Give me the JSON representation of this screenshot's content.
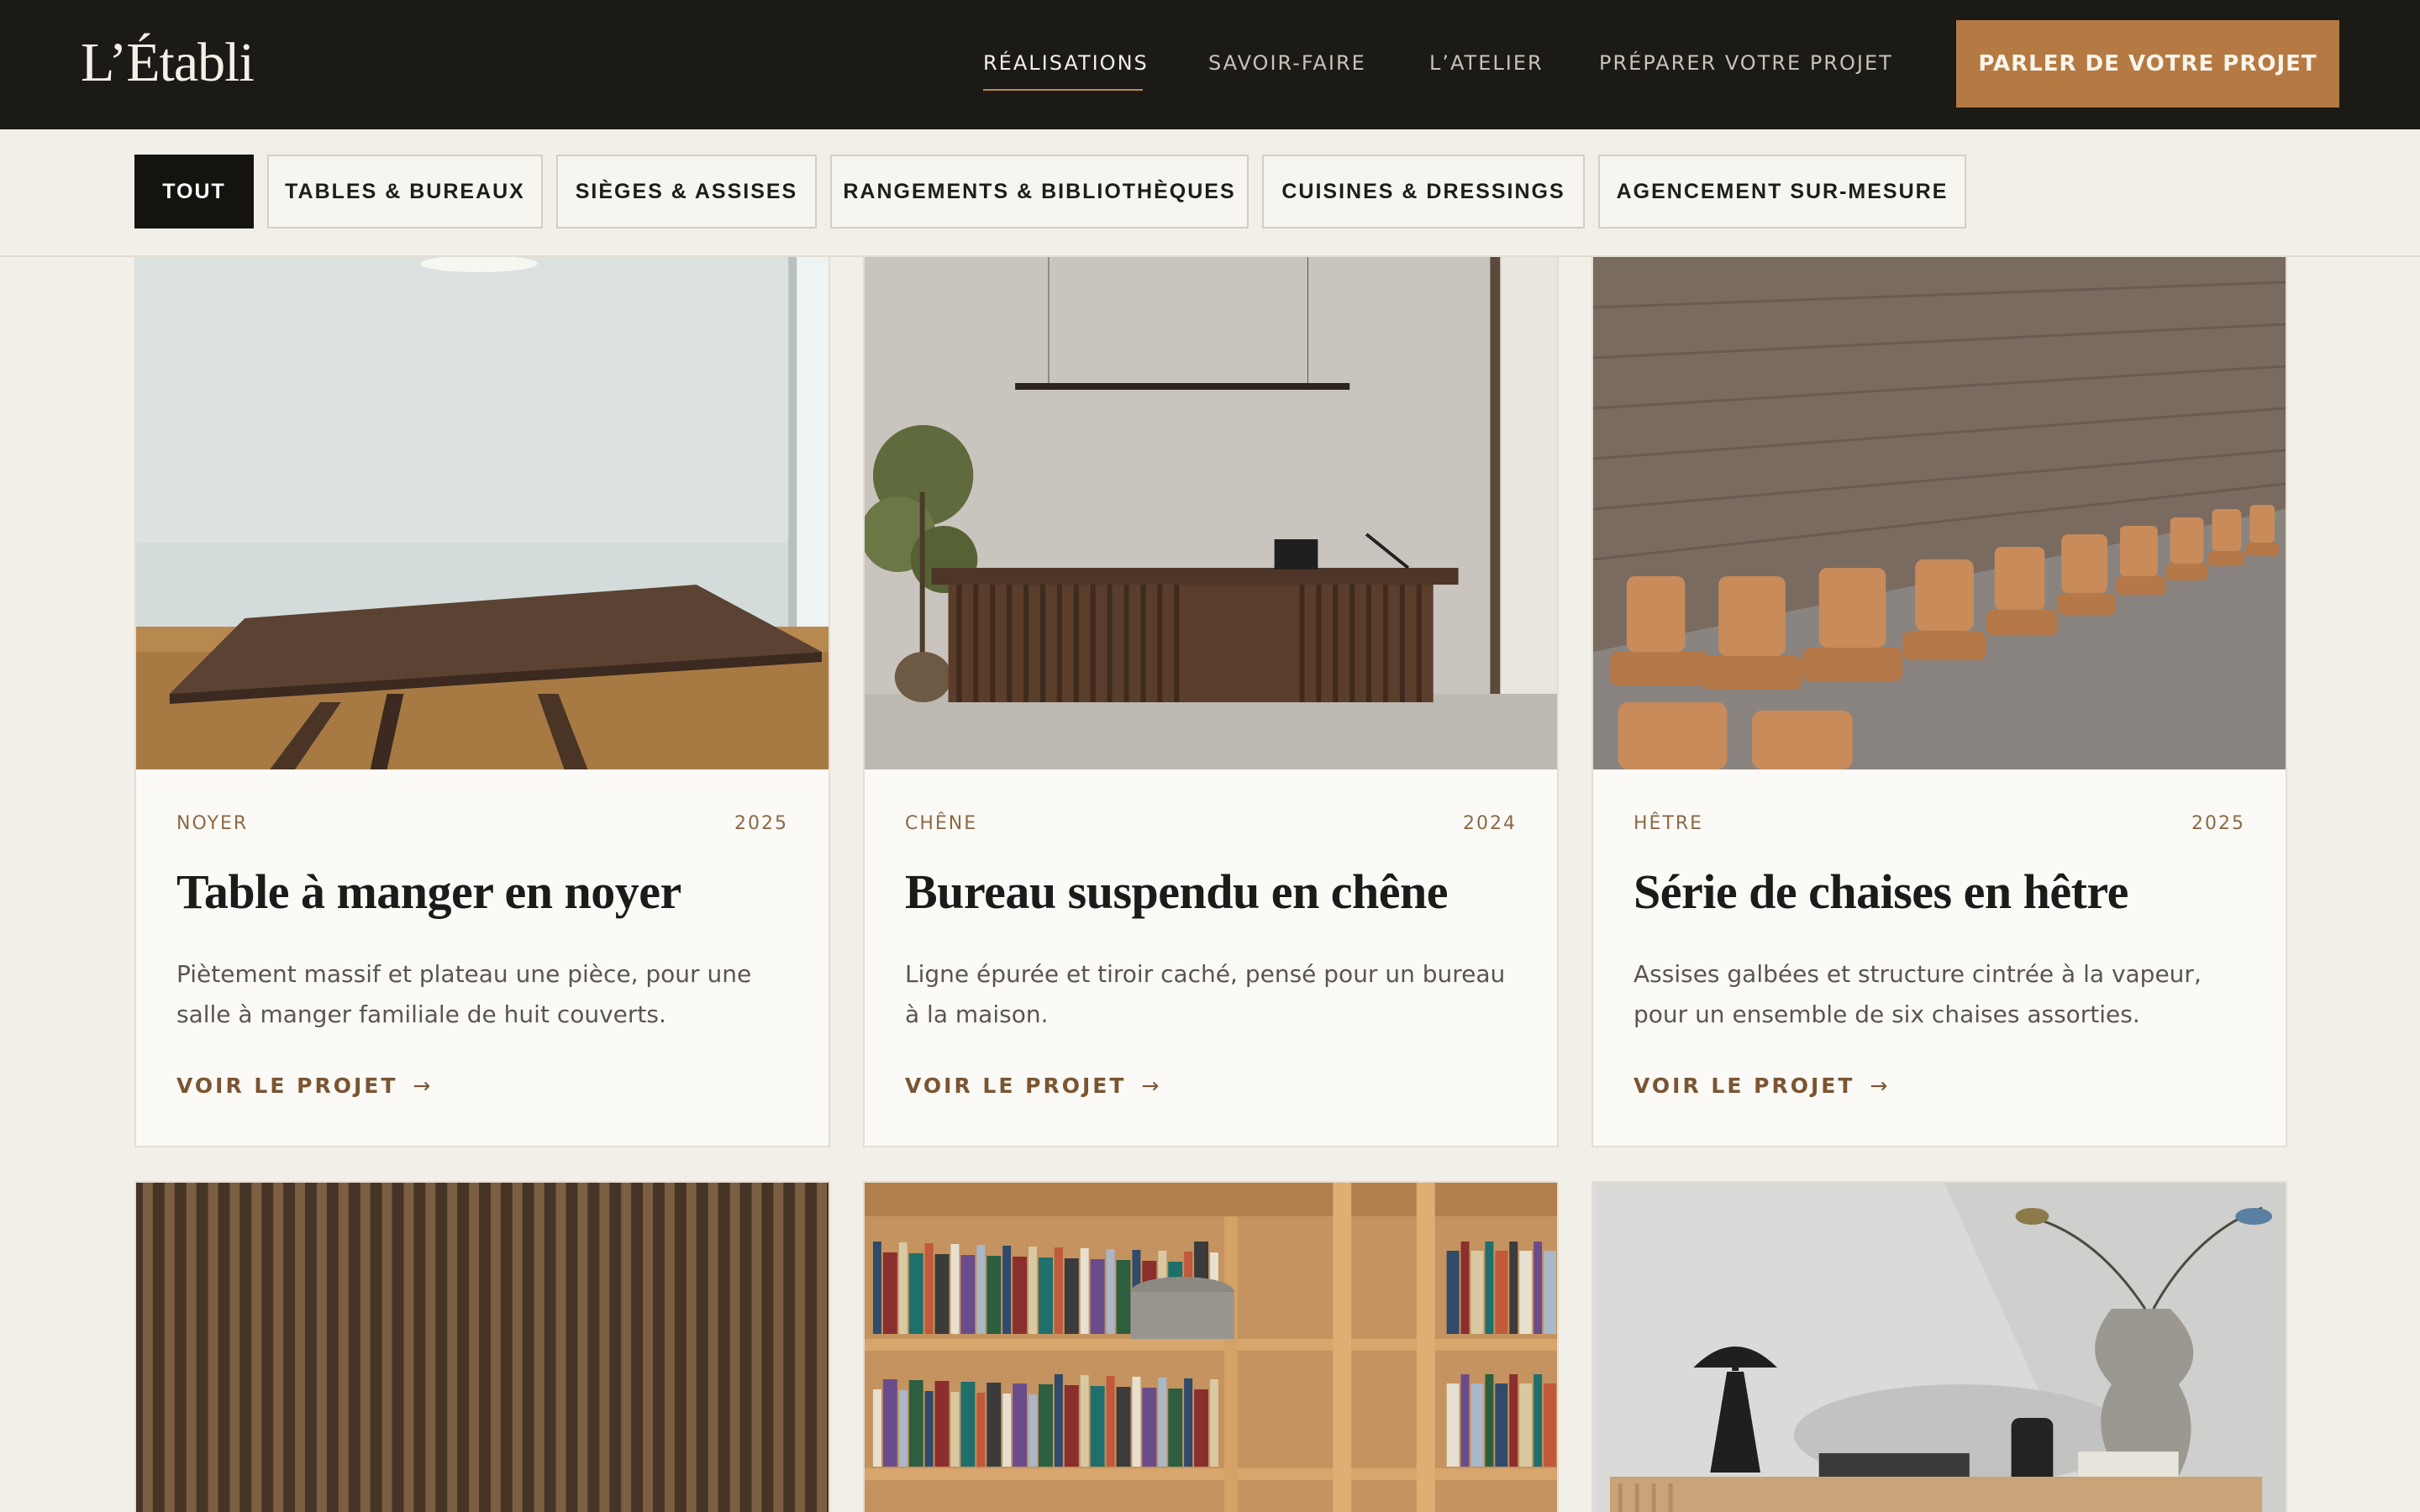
{
  "brand": {
    "logo": "L’Établi"
  },
  "nav": {
    "items": [
      "RÉALISATIONS",
      "SAVOIR-FAIRE",
      "L’ATELIER",
      "PRÉPARER VOTRE PROJET"
    ],
    "active_index": 0,
    "cta_label": "PARLER DE VOTRE PROJET"
  },
  "filters": {
    "items": [
      "TOUT",
      "TABLES & BUREAUX",
      "SIÈGES & ASSISES",
      "RANGEMENTS & BIBLIOTHÈQUES",
      "CUISINES & DRESSINGS",
      "AGENCEMENT SUR-MESURE"
    ],
    "active_index": 0
  },
  "projects": [
    {
      "material": "NOYER",
      "year": "2025",
      "title": "Table à manger en noyer",
      "description": "Piètement massif et plateau une pièce, pour une salle à manger familiale de huit couverts.",
      "link_label": "VOIR LE PROJET",
      "image": "walnut-dining-table"
    },
    {
      "material": "CHÊNE",
      "year": "2024",
      "title": "Bureau suspendu en chêne",
      "description": "Ligne épurée et tiroir caché, pensé pour un bureau à la maison.",
      "link_label": "VOIR LE PROJET",
      "image": "oak-desk"
    },
    {
      "material": "HÊTRE",
      "year": "2025",
      "title": "Série de chaises en hêtre",
      "description": "Assises galbées et structure cintrée à la vapeur, pour un ensemble de six chaises assorties.",
      "link_label": "VOIR LE PROJET",
      "image": "beech-chairs-row"
    },
    {
      "image": "wood-slat-wall"
    },
    {
      "image": "bookshelf-with-ladder"
    },
    {
      "image": "sideboard-with-lamp-and-vase"
    }
  ],
  "icons": {
    "arrow": "→",
    "arrow_name": "arrow-right-icon"
  },
  "colors": {
    "header_bg": "#1b1a17",
    "accent": "#b57a43",
    "meta": "#8a6a47",
    "page_bg": "#f2efe8"
  }
}
